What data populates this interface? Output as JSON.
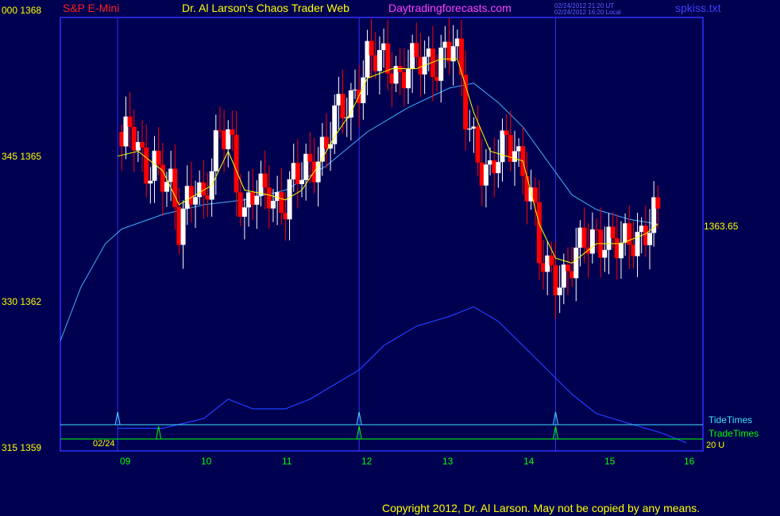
{
  "header": {
    "instrument": "S&P E-Mini",
    "site": "Dr. Al Larson's Chaos Trader Web",
    "brand": "Daytradingforecasts.com",
    "timestamp_ut": "02/24/2012 21:20 UT",
    "timestamp_local": "02/24/2012 16:20 Local",
    "file": "spkiss.txt"
  },
  "footer": {
    "copyright": "Copyright 2012, Dr. Al Larson. May not be copied by any means."
  },
  "colors": {
    "background": "#000050",
    "frame": "#3030ff",
    "up_bar": "#ffffff",
    "down_bar": "#ff0000",
    "fast_ma": "#ffff00",
    "slow_ma": "#40b0ff",
    "volume_line": "#2040ff",
    "tide_times": "#40e0ff",
    "trade_times": "#00ff00"
  },
  "chart_data": {
    "type": "candlestick",
    "title": "S&P E-Mini",
    "ylim": [
      1359,
      1368
    ],
    "y_ticks": [
      {
        "label": "000  1368",
        "value": 1368
      },
      {
        "label": "345  1365",
        "value": 1365
      },
      {
        "label": "330  1362",
        "value": 1362
      },
      {
        "label": "315  1359",
        "value": 1359
      }
    ],
    "x_ticks": [
      "09",
      "10",
      "11",
      "12",
      "13",
      "14",
      "15",
      "16"
    ],
    "date_label": "02/24",
    "last_price": "1363.65",
    "time_label": "20 U",
    "legend": [
      {
        "name": "TideTimes",
        "color": "#40e0ff"
      },
      {
        "name": "TradeTimes",
        "color": "#00ff00"
      }
    ],
    "price_path": [
      [
        8.95,
        1365.5
      ],
      [
        9.0,
        1365.2
      ],
      [
        9.1,
        1365.5
      ],
      [
        9.2,
        1365.0
      ],
      [
        9.3,
        1364.8
      ],
      [
        9.4,
        1365.0
      ],
      [
        9.5,
        1364.6
      ],
      [
        9.6,
        1364.2
      ],
      [
        9.7,
        1363.4
      ],
      [
        9.8,
        1364.2
      ],
      [
        9.9,
        1364.6
      ],
      [
        10.0,
        1364.0
      ],
      [
        10.1,
        1364.6
      ],
      [
        10.2,
        1365.4
      ],
      [
        10.3,
        1365.6
      ],
      [
        10.35,
        1365.3
      ],
      [
        10.4,
        1364.6
      ],
      [
        10.5,
        1363.7
      ],
      [
        10.6,
        1364.1
      ],
      [
        10.7,
        1364.2
      ],
      [
        10.8,
        1364.4
      ],
      [
        10.9,
        1364.1
      ],
      [
        11.0,
        1364.0
      ],
      [
        11.1,
        1364.4
      ],
      [
        11.2,
        1364.6
      ],
      [
        11.3,
        1364.9
      ],
      [
        11.4,
        1365.1
      ],
      [
        11.5,
        1365.2
      ],
      [
        11.6,
        1365.7
      ],
      [
        11.7,
        1365.9
      ],
      [
        11.8,
        1366.2
      ],
      [
        11.9,
        1366.6
      ],
      [
        12.0,
        1367.0
      ],
      [
        12.1,
        1366.9
      ],
      [
        12.2,
        1366.9
      ],
      [
        12.3,
        1366.9
      ],
      [
        12.4,
        1366.7
      ],
      [
        12.5,
        1366.9
      ],
      [
        12.6,
        1366.8
      ],
      [
        12.7,
        1366.9
      ],
      [
        12.8,
        1366.9
      ],
      [
        12.9,
        1367.2
      ],
      [
        13.0,
        1367.2
      ],
      [
        13.05,
        1367.3
      ],
      [
        13.1,
        1366.9
      ],
      [
        13.15,
        1366.4
      ],
      [
        13.2,
        1365.8
      ],
      [
        13.3,
        1365.4
      ],
      [
        13.4,
        1364.9
      ],
      [
        13.5,
        1364.6
      ],
      [
        13.6,
        1364.9
      ],
      [
        13.7,
        1365.2
      ],
      [
        13.8,
        1365.3
      ],
      [
        13.9,
        1364.8
      ],
      [
        14.0,
        1364.2
      ],
      [
        14.05,
        1363.6
      ],
      [
        14.1,
        1362.8
      ],
      [
        14.2,
        1362.6
      ],
      [
        14.3,
        1362.6
      ],
      [
        14.4,
        1362.6
      ],
      [
        14.5,
        1362.8
      ],
      [
        14.6,
        1363.0
      ],
      [
        14.7,
        1363.2
      ],
      [
        14.8,
        1363.4
      ],
      [
        14.9,
        1363.4
      ],
      [
        15.0,
        1363.2
      ],
      [
        15.1,
        1363.0
      ],
      [
        15.2,
        1363.2
      ],
      [
        15.3,
        1363.4
      ],
      [
        15.4,
        1363.6
      ],
      [
        15.5,
        1363.8
      ],
      [
        15.55,
        1363.65
      ]
    ],
    "fast_ma": [
      [
        8.95,
        1365.0
      ],
      [
        9.2,
        1365.1
      ],
      [
        9.5,
        1364.7
      ],
      [
        9.7,
        1364.0
      ],
      [
        9.9,
        1364.2
      ],
      [
        10.1,
        1364.4
      ],
      [
        10.3,
        1365.1
      ],
      [
        10.5,
        1364.3
      ],
      [
        10.8,
        1364.2
      ],
      [
        11.0,
        1364.1
      ],
      [
        11.2,
        1364.3
      ],
      [
        11.4,
        1364.8
      ],
      [
        11.6,
        1365.4
      ],
      [
        11.8,
        1365.9
      ],
      [
        12.0,
        1366.6
      ],
      [
        12.3,
        1366.8
      ],
      [
        12.6,
        1366.8
      ],
      [
        12.9,
        1367.0
      ],
      [
        13.1,
        1367.0
      ],
      [
        13.3,
        1365.9
      ],
      [
        13.5,
        1365.1
      ],
      [
        13.7,
        1365.0
      ],
      [
        13.9,
        1364.9
      ],
      [
        14.1,
        1363.6
      ],
      [
        14.3,
        1362.9
      ],
      [
        14.5,
        1362.8
      ],
      [
        14.8,
        1363.2
      ],
      [
        15.1,
        1363.2
      ],
      [
        15.4,
        1363.4
      ],
      [
        15.55,
        1363.6
      ]
    ],
    "slow_ma": [
      [
        8.25,
        1361.2
      ],
      [
        8.5,
        1362.3
      ],
      [
        8.8,
        1363.2
      ],
      [
        9.0,
        1363.5
      ],
      [
        9.5,
        1363.8
      ],
      [
        10.0,
        1364.0
      ],
      [
        10.5,
        1364.1
      ],
      [
        11.0,
        1364.3
      ],
      [
        11.5,
        1364.8
      ],
      [
        12.0,
        1365.5
      ],
      [
        12.5,
        1366.0
      ],
      [
        13.0,
        1366.4
      ],
      [
        13.3,
        1366.5
      ],
      [
        13.6,
        1366.1
      ],
      [
        13.9,
        1365.6
      ],
      [
        14.2,
        1364.9
      ],
      [
        14.5,
        1364.2
      ],
      [
        14.8,
        1363.9
      ],
      [
        15.2,
        1363.7
      ],
      [
        15.55,
        1363.6
      ]
    ],
    "series": [
      {
        "name": "TideTimes"
      },
      {
        "name": "TradeTimes"
      }
    ]
  }
}
